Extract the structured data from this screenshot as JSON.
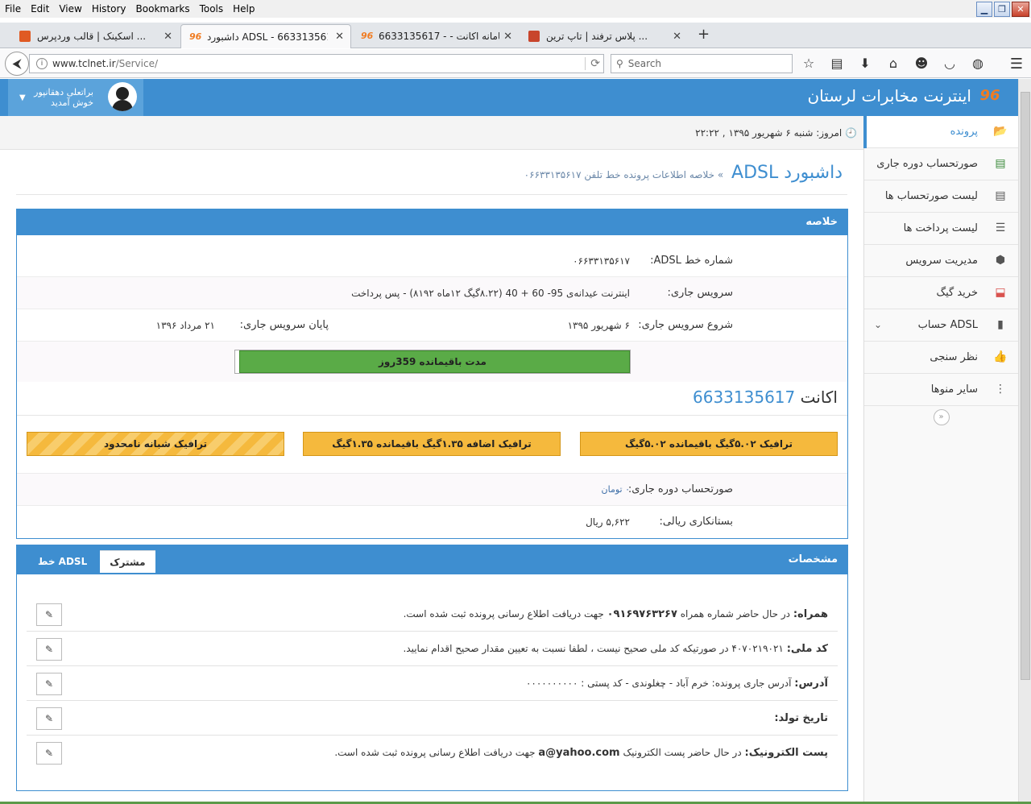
{
  "browser": {
    "menu": [
      "File",
      "Edit",
      "View",
      "History",
      "Bookmarks",
      "Tools",
      "Help"
    ],
    "tabs": [
      {
        "label": "اسکینک | قالب وردپرس ...",
        "color": "#e05a23"
      },
      {
        "label": "داشبورد ADSL - 6633135617...",
        "color": "#f07c22"
      },
      {
        "label": "سامانه اکانت - - 6633135617...",
        "color": "#f07c22"
      },
      {
        "label": "پلاس ترفند | تاپ ترین ...",
        "color": "#c8452c"
      }
    ],
    "url_host": "www.tclnet.ir",
    "url_path": "/Service/",
    "search_placeholder": "Search"
  },
  "header": {
    "brand": "اینترنت مخابرات لرستان",
    "logo": "96",
    "user_name": "براتعلی دهقانپور",
    "welcome": "خوش آمدید"
  },
  "datebar": {
    "text": "امروز: شنبه ۶ شهریور ۱۳۹۵ , ۲۲:۲۲"
  },
  "sidebar": {
    "items": [
      {
        "label": "پرونده",
        "icon": "folder-open-icon",
        "glyph": "📂"
      },
      {
        "label": "صورتحساب دوره جاری",
        "icon": "invoice-icon",
        "glyph": "▤"
      },
      {
        "label": "لیست صورتحساب ها",
        "icon": "list-alt-icon",
        "glyph": "▤"
      },
      {
        "label": "لیست پرداخت ها",
        "icon": "list-icon",
        "glyph": "☰"
      },
      {
        "label": "مدیریت سرویس",
        "icon": "cubes-icon",
        "glyph": "⬢"
      },
      {
        "label": "خرید گیگ",
        "icon": "inbox-icon",
        "glyph": "⬓"
      },
      {
        "label": "حساب ADSL",
        "icon": "file-icon",
        "glyph": "▮"
      },
      {
        "label": "نظر سنجی",
        "icon": "thumbs-up-icon",
        "glyph": "👍"
      },
      {
        "label": "سایر منوها",
        "icon": "ellipsis-icon",
        "glyph": "⋮"
      }
    ]
  },
  "page": {
    "title": "داشبورد ADSL",
    "breadcrumb": "خلاصه اطلاعات پرونده خط تلفن ۰۶۶۳۳۱۳۵۶۱۷"
  },
  "summary": {
    "title": "خلاصه",
    "line_label": "شماره خط ADSL:",
    "line_value": "۰۶۶۳۳۱۳۵۶۱۷",
    "service_label": "سرویس جاری:",
    "service_value": "اینترنت عیدانه‌ی 95- 60 + 40 (۸.۲۲گیگ ۱۲ماه ۸۱۹۲) - پس پرداخت",
    "start_label": "شروع سرویس جاری:",
    "start_value": "۶ شهریور ۱۳۹۵",
    "end_label": "پایان سرویس جاری:",
    "end_value": "۲۱ مرداد ۱۳۹۶",
    "progress_text": "مدت باقیمانده 359روز",
    "progress_fraction": 0.99,
    "account_label": "اکانت",
    "account_number": "6633135617",
    "traffic": [
      "ترافیک ۵.۰۲گیگ باقیمانده ۵.۰۲گیگ",
      "ترافیک اضافه ۱.۳۵گیگ باقیمانده ۱.۳۵گیگ",
      "ترافیک شبانه نامحدود"
    ],
    "bill_label": "صورتحساب دوره جاری:",
    "bill_value": "۰ تومان",
    "credit_label": "بستانکاری ریالی:",
    "credit_value": "۵,۶۲۲ ریال"
  },
  "specs": {
    "title": "مشخصات",
    "tabs": [
      "مشترک",
      "خط ADSL"
    ],
    "fields": [
      {
        "label": "همراه:",
        "pre": "در حال حاضر شماره همراه",
        "strong": "۰۹۱۶۹۷۶۳۲۶۷",
        "post": "جهت دریافت اطلاع رسانی پرونده ثبت شده است."
      },
      {
        "label": "کد ملی:",
        "pre": "۴۰۷۰۲۱۹۰۲۱",
        "strong": "",
        "post": "در صورتیکه کد ملی صحیح نیست ، لطفا نسبت به تعیین مقدار صحیح اقدام نمایید."
      },
      {
        "label": "آدرس:",
        "pre": "آدرس جاری پرونده: خرم آباد - چغلوندی - کد پستی : ۰۰۰۰۰۰۰۰۰۰",
        "strong": "",
        "post": ""
      },
      {
        "label": "تاریخ تولد:",
        "pre": "",
        "strong": "",
        "post": ""
      },
      {
        "label": "پست الکترونیک:",
        "pre": "در حال حاضر پست الکترونیک",
        "strong": "a@yahoo.com",
        "post": "جهت دریافت اطلاع رسانی پرونده ثبت شده است."
      }
    ]
  }
}
